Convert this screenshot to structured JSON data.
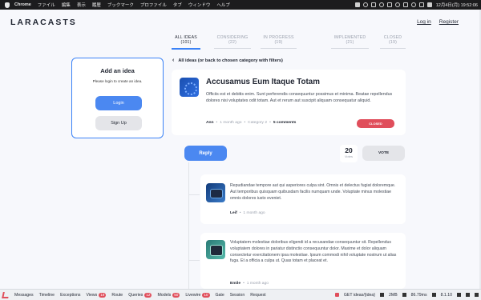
{
  "menubar": {
    "app": "Chrome",
    "items": [
      "ファイル",
      "編集",
      "表示",
      "履歴",
      "ブックマーク",
      "プロファイル",
      "タブ",
      "ウィンドウ",
      "ヘルプ"
    ],
    "clock": "12月4日(月) 19:52:06"
  },
  "header": {
    "logo": "LARACASTS",
    "login": "Log in",
    "register": "Register"
  },
  "tabs": [
    {
      "label": "ALL IDEAS (101)",
      "active": true
    },
    {
      "label": "CONSIDERING (22)",
      "active": false
    },
    {
      "label": "IN PROGRESS (19)",
      "active": false
    },
    {
      "label": "IMPLEMENTED (21)",
      "active": false
    },
    {
      "label": "CLOSED (19)",
      "active": false
    }
  ],
  "sidebar": {
    "title": "Add an idea",
    "subtitle": "Please login to create an idea.",
    "login_label": "Login",
    "signup_label": "Sign Up"
  },
  "back_link": "All ideas (or back to chosen category with filters)",
  "idea": {
    "avatar_icon": "user-avatar-icon",
    "title": "Accusamus Eum Itaque Totam",
    "description": "Officiis est et debitis enim. Sunt perferendis consequuntur possimus et minima. Beatae repellendus dolores nisi voluptates odit totam. Aut et rerum aut suscipit aliquam consequatur aliquid.",
    "author": "Ann",
    "time": "1 month ago",
    "category": "Category 2",
    "comments": "5 comments",
    "status": "CLOSED",
    "status_color": "#e04e5b"
  },
  "actions": {
    "reply_label": "Reply",
    "votes_count": "20",
    "votes_label": "Votes",
    "vote_label": "VOTE"
  },
  "comments": [
    {
      "text": "Repudiandae tempore aut qui asperiores culpa sint. Omnis et delectus fugiat doloremque. Aut temporibus quisquam quibusdam facilis numquam unde. Voluptate minus molestiae omnis dolores iusto eveniet.",
      "author": "Leif",
      "time": "1 month ago"
    },
    {
      "text": "Voluptatem molestiae doloribus eligendi id a recusandae consequuntur sit. Repellendus voluptatem dolores in pariatur distinctio consequuntur dolor. Maxime et dolor aliquam consectetur exercitationem ipsa molestiae. Ipsum commodi nihil voluptate nostrum ut alias fuga. Et a officia a culpa ut. Quas totam et placeat et.",
      "author": "Emile",
      "time": "1 month ago"
    }
  ],
  "debugbar": {
    "items": [
      {
        "label": "Messages",
        "badge": ""
      },
      {
        "label": "Timeline",
        "badge": ""
      },
      {
        "label": "Exceptions",
        "badge": ""
      },
      {
        "label": "Views",
        "badge": "19"
      },
      {
        "label": "Route",
        "badge": ""
      },
      {
        "label": "Queries",
        "badge": "12"
      },
      {
        "label": "Models",
        "badge": "50"
      },
      {
        "label": "Livewire",
        "badge": "10"
      },
      {
        "label": "Gate",
        "badge": ""
      },
      {
        "label": "Session",
        "badge": ""
      },
      {
        "label": "Request",
        "badge": ""
      }
    ],
    "route": "GET ideas/{idea}",
    "memory": "2MB",
    "time": "86.79ms",
    "version": "8.1.10"
  }
}
